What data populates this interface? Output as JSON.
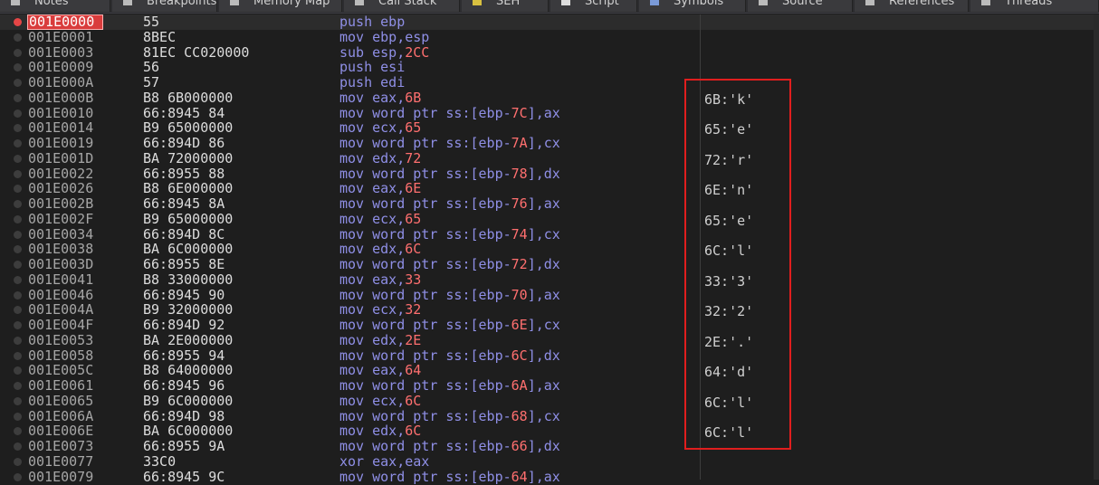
{
  "tabs": [
    {
      "label": "Notes"
    },
    {
      "label": "Breakpoints"
    },
    {
      "label": "Memory Map"
    },
    {
      "label": "Call Stack"
    },
    {
      "label": "SEH"
    },
    {
      "label": "Script"
    },
    {
      "label": "Symbols"
    },
    {
      "label": "Source"
    },
    {
      "label": "References"
    },
    {
      "label": "Threads"
    }
  ],
  "colors": {
    "current_row": "#d93c3c",
    "highlight_box": "#e01e1e",
    "mnemonic": "#8f8fe6",
    "immediate": "#ff6f6f"
  },
  "rows": [
    {
      "addr": "001E0000",
      "bytes": "55",
      "instr": "push ebp"
    },
    {
      "addr": "001E0001",
      "bytes": "8BEC",
      "instr": "mov ebp,esp"
    },
    {
      "addr": "001E0003",
      "bytes": "81EC CC020000",
      "instr": "sub esp,2CC"
    },
    {
      "addr": "001E0009",
      "bytes": "56",
      "instr": "push esi"
    },
    {
      "addr": "001E000A",
      "bytes": "57",
      "instr": "push edi"
    },
    {
      "addr": "001E000B",
      "bytes": "B8 6B000000",
      "instr": "mov eax,6B"
    },
    {
      "addr": "001E0010",
      "bytes": "66:8945 84",
      "instr": "mov word ptr ss:[ebp-7C],ax"
    },
    {
      "addr": "001E0014",
      "bytes": "B9 65000000",
      "instr": "mov ecx,65"
    },
    {
      "addr": "001E0019",
      "bytes": "66:894D 86",
      "instr": "mov word ptr ss:[ebp-7A],cx"
    },
    {
      "addr": "001E001D",
      "bytes": "BA 72000000",
      "instr": "mov edx,72"
    },
    {
      "addr": "001E0022",
      "bytes": "66:8955 88",
      "instr": "mov word ptr ss:[ebp-78],dx"
    },
    {
      "addr": "001E0026",
      "bytes": "B8 6E000000",
      "instr": "mov eax,6E"
    },
    {
      "addr": "001E002B",
      "bytes": "66:8945 8A",
      "instr": "mov word ptr ss:[ebp-76],ax"
    },
    {
      "addr": "001E002F",
      "bytes": "B9 65000000",
      "instr": "mov ecx,65"
    },
    {
      "addr": "001E0034",
      "bytes": "66:894D 8C",
      "instr": "mov word ptr ss:[ebp-74],cx"
    },
    {
      "addr": "001E0038",
      "bytes": "BA 6C000000",
      "instr": "mov edx,6C"
    },
    {
      "addr": "001E003D",
      "bytes": "66:8955 8E",
      "instr": "mov word ptr ss:[ebp-72],dx"
    },
    {
      "addr": "001E0041",
      "bytes": "B8 33000000",
      "instr": "mov eax,33"
    },
    {
      "addr": "001E0046",
      "bytes": "66:8945 90",
      "instr": "mov word ptr ss:[ebp-70],ax"
    },
    {
      "addr": "001E004A",
      "bytes": "B9 32000000",
      "instr": "mov ecx,32"
    },
    {
      "addr": "001E004F",
      "bytes": "66:894D 92",
      "instr": "mov word ptr ss:[ebp-6E],cx"
    },
    {
      "addr": "001E0053",
      "bytes": "BA 2E000000",
      "instr": "mov edx,2E"
    },
    {
      "addr": "001E0058",
      "bytes": "66:8955 94",
      "instr": "mov word ptr ss:[ebp-6C],dx"
    },
    {
      "addr": "001E005C",
      "bytes": "B8 64000000",
      "instr": "mov eax,64"
    },
    {
      "addr": "001E0061",
      "bytes": "66:8945 96",
      "instr": "mov word ptr ss:[ebp-6A],ax"
    },
    {
      "addr": "001E0065",
      "bytes": "B9 6C000000",
      "instr": "mov ecx,6C"
    },
    {
      "addr": "001E006A",
      "bytes": "66:894D 98",
      "instr": "mov word ptr ss:[ebp-68],cx"
    },
    {
      "addr": "001E006E",
      "bytes": "BA 6C000000",
      "instr": "mov edx,6C"
    },
    {
      "addr": "001E0073",
      "bytes": "66:8955 9A",
      "instr": "mov word ptr ss:[ebp-66],dx"
    },
    {
      "addr": "001E0077",
      "bytes": "33C0",
      "instr": "xor eax,eax"
    },
    {
      "addr": "001E0079",
      "bytes": "66:8945 9C",
      "instr": "mov word ptr ss:[ebp-64],ax"
    }
  ],
  "comments": [
    "6B:'k'",
    "65:'e'",
    "72:'r'",
    "6E:'n'",
    "65:'e'",
    "6C:'l'",
    "33:'3'",
    "32:'2'",
    "2E:'.'",
    "64:'d'",
    "6C:'l'",
    "6C:'l'"
  ]
}
